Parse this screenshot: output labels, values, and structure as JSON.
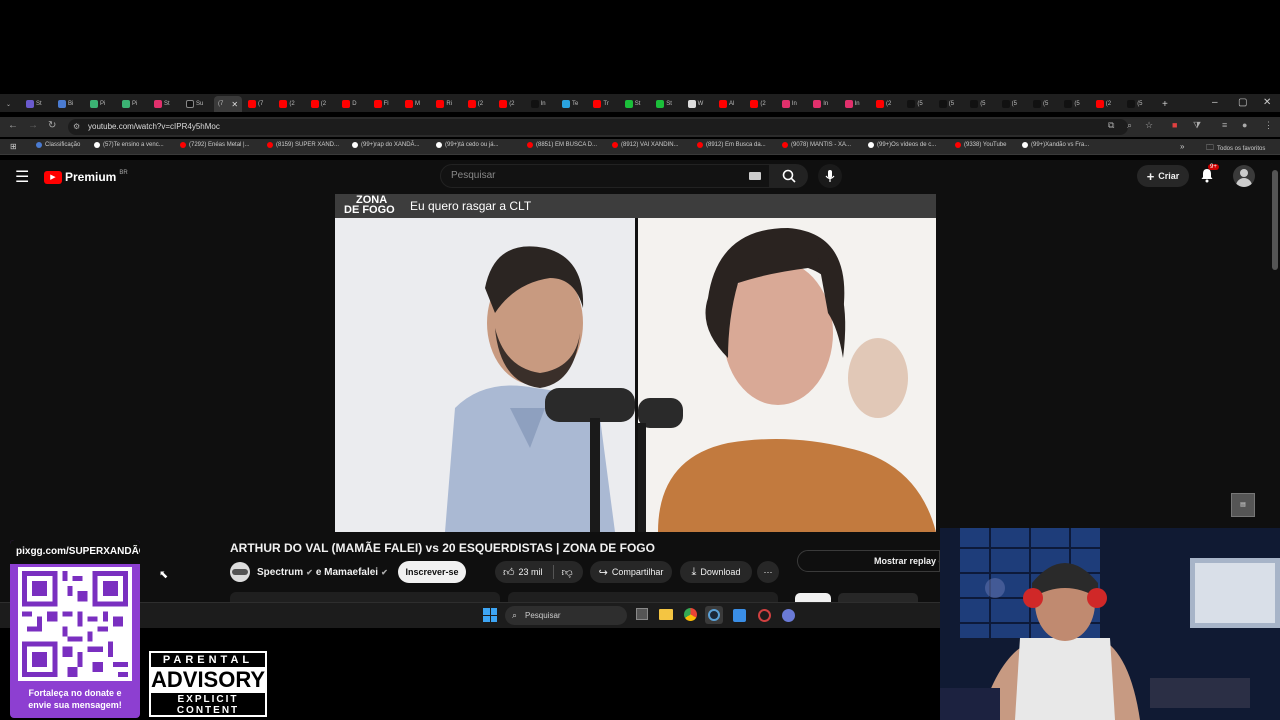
{
  "browser": {
    "tabs": [
      "St",
      "Bi",
      "Pi",
      "Pi",
      "St",
      "Su",
      "(7"
    ],
    "more_tabs": [
      "(7",
      "(2",
      "(2",
      "D",
      "Fl",
      "M",
      "Ri",
      "(2",
      "(2",
      "In",
      "Te",
      "Tr",
      "St",
      "St",
      "W",
      "Al",
      "(2",
      "In",
      "In",
      "In",
      "(2",
      "(5",
      "(5",
      "(5",
      "(5",
      "(5",
      "(5",
      "(2",
      "(5"
    ],
    "url": "youtube.com/watch?v=cIPR4y5hMoc",
    "bookmarks": [
      {
        "label": "Classificação",
        "color": "#4a7bd1"
      },
      {
        "label": "(57)Te ensino a venc...",
        "color": "#ffffff"
      },
      {
        "label": "(7292) Enéas Metal |...",
        "color": "#ff0000"
      },
      {
        "label": "(8159) SUPER XAND...",
        "color": "#ff0000"
      },
      {
        "label": "(99+)rap do XANDÃ...",
        "color": "#ffffff"
      },
      {
        "label": "(99+)tá cedo ou já...",
        "color": "#ffffff"
      },
      {
        "label": "(8851) EM BUSCA D...",
        "color": "#ff0000"
      },
      {
        "label": "(8912) VAI XANDIN...",
        "color": "#ff0000"
      },
      {
        "label": "(8912) Em Busca da...",
        "color": "#ff0000"
      },
      {
        "label": "(9078) MANTIS - XA...",
        "color": "#ff0000"
      },
      {
        "label": "(99+)Os vídeos de c...",
        "color": "#ffffff"
      },
      {
        "label": "(9338) YouTube",
        "color": "#ff0000"
      },
      {
        "label": "(99+)Xandão vs Fra...",
        "color": "#ffffff"
      }
    ],
    "all_favorites": "Todos os favoritos"
  },
  "youtube": {
    "logo_text": "Premium",
    "country": "BR",
    "search_placeholder": "Pesquisar",
    "create_label": "Criar",
    "notif_badge": "9+",
    "video": {
      "banner_brand_line1": "ZONA",
      "banner_brand_line2": "DE FOGO",
      "banner_caption": "Eu quero rasgar a CLT",
      "title": "ARTHUR DO VAL (MAMÃE FALEI) vs 20 ESQUERDISTAS | ZONA DE FOGO",
      "channel": "Spectrum",
      "collab": "e Mamaefalei",
      "subscribe": "Inscrever-se",
      "likes": "23 mil",
      "share": "Compartilhar",
      "download": "Download",
      "chat_replay": "Mostrar replay do"
    }
  },
  "taskbar": {
    "search_placeholder": "Pesquisar"
  },
  "overlay": {
    "pix_url": "pixgg.com/SUPERXANDÃO",
    "donate_text_1": "Fortaleça no donate e",
    "donate_text_2": "envie sua mensagem!",
    "advisory_top": "PARENTAL",
    "advisory_main": "ADVISORY",
    "advisory_bottom": "EXPLICIT CONTENT"
  },
  "colors": {
    "yt_red": "#ff0000",
    "yt_bg": "#0f0f0f",
    "overlay_purple": "#8d3fd1"
  }
}
